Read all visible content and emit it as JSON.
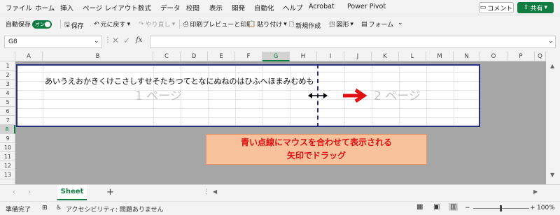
{
  "menu": [
    "ファイル",
    "ホーム",
    "挿入",
    "ページ レイアウト",
    "数式",
    "データ",
    "校閲",
    "表示",
    "開発",
    "自動化",
    "ヘルプ",
    "Acrobat",
    "Power Pivot"
  ],
  "comment_label": "コメント",
  "share_label": "共有",
  "toolbar": {
    "autosave_label": "自動保存",
    "autosave_state": "オン",
    "save_label": "保存",
    "undo_label": "元に戻す",
    "redo_label": "やり直し",
    "print_preview_label": "印刷プレビューと印刷",
    "paste_label": "貼り付け",
    "new_label": "新規作成",
    "shapes_label": "図形",
    "form_label": "フォーム"
  },
  "formula_bar": {
    "name_box": "G8",
    "fx": "fx",
    "value": ""
  },
  "columns": [
    "A",
    "B",
    "C",
    "D",
    "E",
    "F",
    "G",
    "H",
    "I",
    "J",
    "K",
    "L",
    "M",
    "N",
    "O",
    "P",
    "Q"
  ],
  "selected_column": "G",
  "rows": [
    "1",
    "2",
    "3",
    "4",
    "5",
    "6",
    "7",
    "8",
    "9",
    "10",
    "11",
    "12",
    "13"
  ],
  "selected_row": "8",
  "cell_text": "あいうえおかきくけこさしすせそたちつてとなにぬねのはひふへほまみむめも",
  "page1_label": "1 ページ",
  "page2_label": "2 ページ",
  "callout": {
    "line1": "青い点線にマウスを合わせて表示される",
    "line2": "矢印でドラッグ"
  },
  "sheet_tab": "Sheet",
  "status": {
    "ready": "準備完了",
    "accessibility": "アクセシビリティ: 問題ありません",
    "zoom": "100%"
  },
  "colors": {
    "accent": "#107c41",
    "page_border": "#27307f",
    "callout_bg": "#f8c29d",
    "callout_text": "#e01010",
    "arrow": "#e01010"
  }
}
